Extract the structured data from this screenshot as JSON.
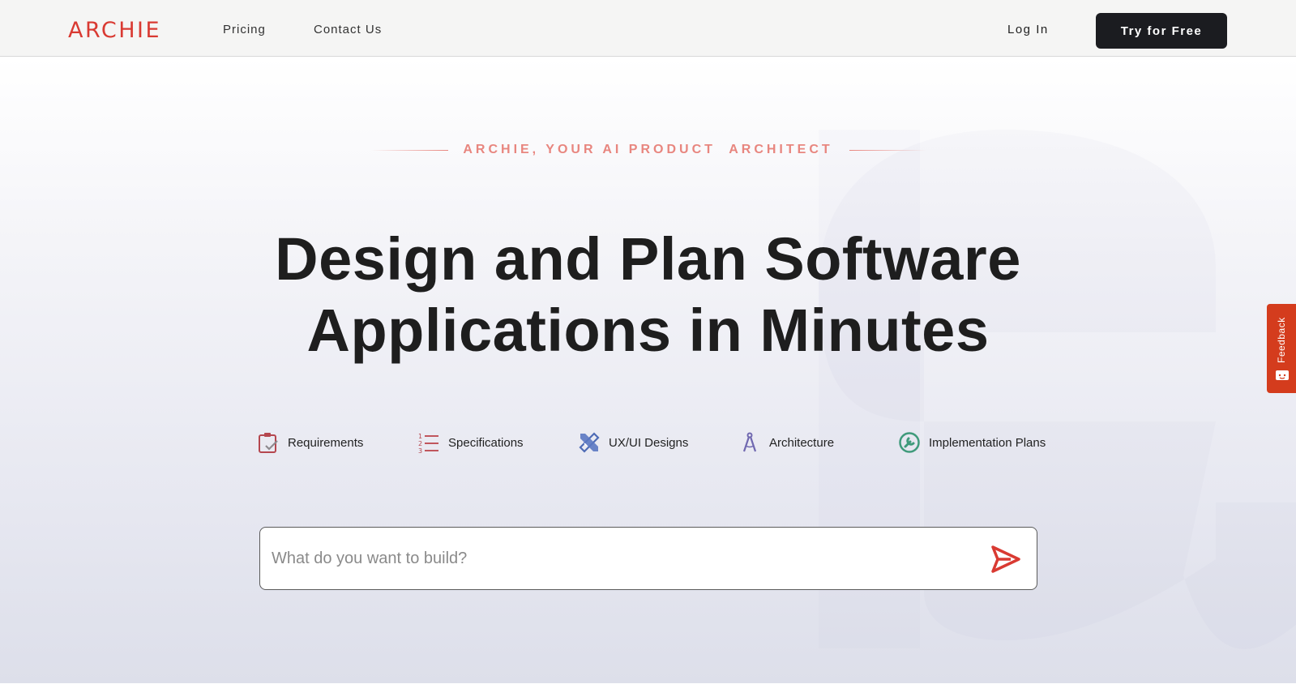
{
  "header": {
    "logo": "ARCHIE",
    "nav": [
      {
        "label": "Pricing"
      },
      {
        "label": "Contact Us"
      }
    ],
    "login_label": "Log In",
    "cta_label": "Try for Free"
  },
  "hero": {
    "eyebrow": "ARCHIE, YOUR AI PRODUCT  ARCHITECT",
    "headline_line1": "Design and Plan Software",
    "headline_line2": "Applications in Minutes",
    "features": [
      {
        "label": "Requirements",
        "icon": "clipboard-check-icon"
      },
      {
        "label": "Specifications",
        "icon": "numbered-list-icon"
      },
      {
        "label": "UX/UI Designs",
        "icon": "ruler-pencil-icon"
      },
      {
        "label": "Architecture",
        "icon": "compass-icon"
      },
      {
        "label": "Implementation Plans",
        "icon": "wrench-circle-icon"
      }
    ],
    "search_placeholder": "What do you want to build?"
  },
  "feedback": {
    "label": "Feedback"
  },
  "colors": {
    "brand": "#d93a32",
    "eyebrow": "#e8867f",
    "cta_bg": "#1b1c20",
    "feedback_bg": "#d43c1d"
  }
}
